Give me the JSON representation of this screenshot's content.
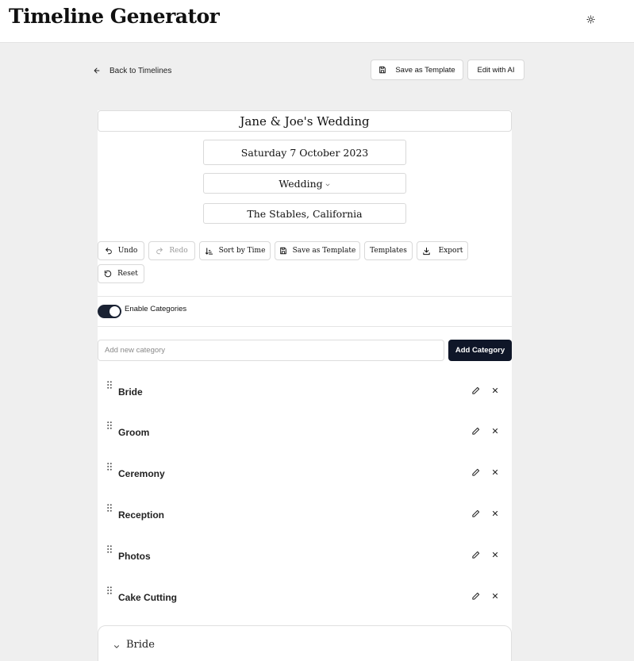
{
  "header": {
    "app_title": "Timeline Generator",
    "theme_icon": "sun-icon"
  },
  "nav": {
    "back_label": "Back to Timelines",
    "save_template_label": "Save as Template",
    "edit_ai_label": "Edit with AI"
  },
  "event": {
    "title": "Jane & Joe's Wedding",
    "date": "Saturday 7 October 2023",
    "type": "Wedding",
    "location": "The Stables, California"
  },
  "toolbar": {
    "undo": "Undo",
    "redo": "Redo",
    "sort": "Sort by Time",
    "save_template": "Save as Template",
    "templates": "Templates",
    "export": "Export",
    "reset": "Reset"
  },
  "categories": {
    "toggle_label": "Enable Categories",
    "enabled": true,
    "input_placeholder": "Add new category",
    "add_button": "Add Category",
    "items": [
      {
        "label": "Bride"
      },
      {
        "label": "Groom"
      },
      {
        "label": "Ceremony"
      },
      {
        "label": "Reception"
      },
      {
        "label": "Photos"
      },
      {
        "label": "Cake Cutting"
      }
    ]
  },
  "section": {
    "title": "Bride"
  },
  "colors": {
    "accent": "#0f1628",
    "background": "#efefef"
  }
}
